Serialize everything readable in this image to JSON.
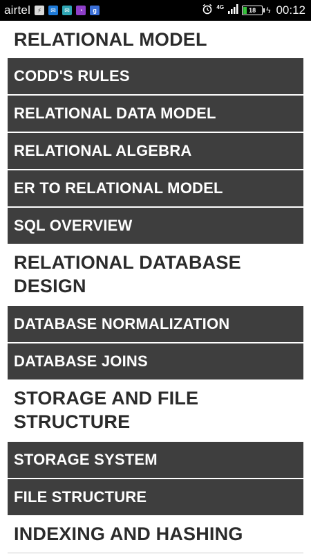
{
  "status_bar": {
    "carrier": "airtel",
    "network": "4G",
    "battery_level": "18",
    "battery_fraction": 0.18,
    "time": "00:12"
  },
  "sections": [
    {
      "title": "RELATIONAL MODEL",
      "items": [
        "CODD'S RULES",
        "RELATIONAL DATA MODEL",
        "RELATIONAL ALGEBRA",
        "ER TO RELATIONAL MODEL",
        "SQL OVERVIEW"
      ]
    },
    {
      "title": "RELATIONAL DATABASE DESIGN",
      "items": [
        "DATABASE NORMALIZATION",
        "DATABASE JOINS"
      ]
    },
    {
      "title": "STORAGE AND FILE STRUCTURE",
      "items": [
        "STORAGE SYSTEM",
        "FILE STRUCTURE"
      ]
    },
    {
      "title": "INDEXING AND HASHING",
      "items": []
    }
  ]
}
